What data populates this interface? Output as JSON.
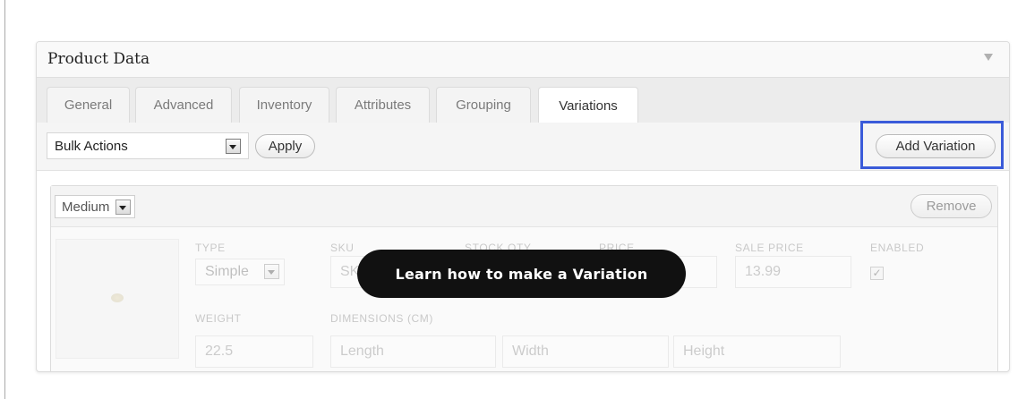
{
  "panel": {
    "title": "Product Data"
  },
  "tabs": [
    {
      "label": "General"
    },
    {
      "label": "Advanced"
    },
    {
      "label": "Inventory"
    },
    {
      "label": "Attributes"
    },
    {
      "label": "Grouping"
    },
    {
      "label": "Variations",
      "active": true
    }
  ],
  "toolbar": {
    "bulk_select": "Bulk Actions",
    "apply_label": "Apply",
    "add_variation_label": "Add Variation"
  },
  "variation": {
    "attribute_select": "Medium",
    "remove_label": "Remove",
    "labels": {
      "type": "TYPE",
      "sku": "SKU",
      "stock_qty": "STOCK QTY",
      "price": "PRICE",
      "sale_price": "SALE PRICE",
      "enabled": "ENABLED",
      "weight": "WEIGHT",
      "dimensions": "DIMENSIONS (CM)"
    },
    "type_value": "Simple",
    "sku_placeholder": "SKU",
    "sale_price_value": "13.99",
    "enabled_check": "✓",
    "weight_value": "22.5",
    "length_placeholder": "Length",
    "width_placeholder": "Width",
    "height_placeholder": "Height"
  },
  "tooltip": {
    "text": "Learn how to make a Variation"
  },
  "colors": {
    "highlight": "#3a5bd9",
    "tooltip_bg": "#111111"
  },
  "icons": {
    "collapse": "triangle-down-icon",
    "select": "dropdown-arrow-icon"
  }
}
